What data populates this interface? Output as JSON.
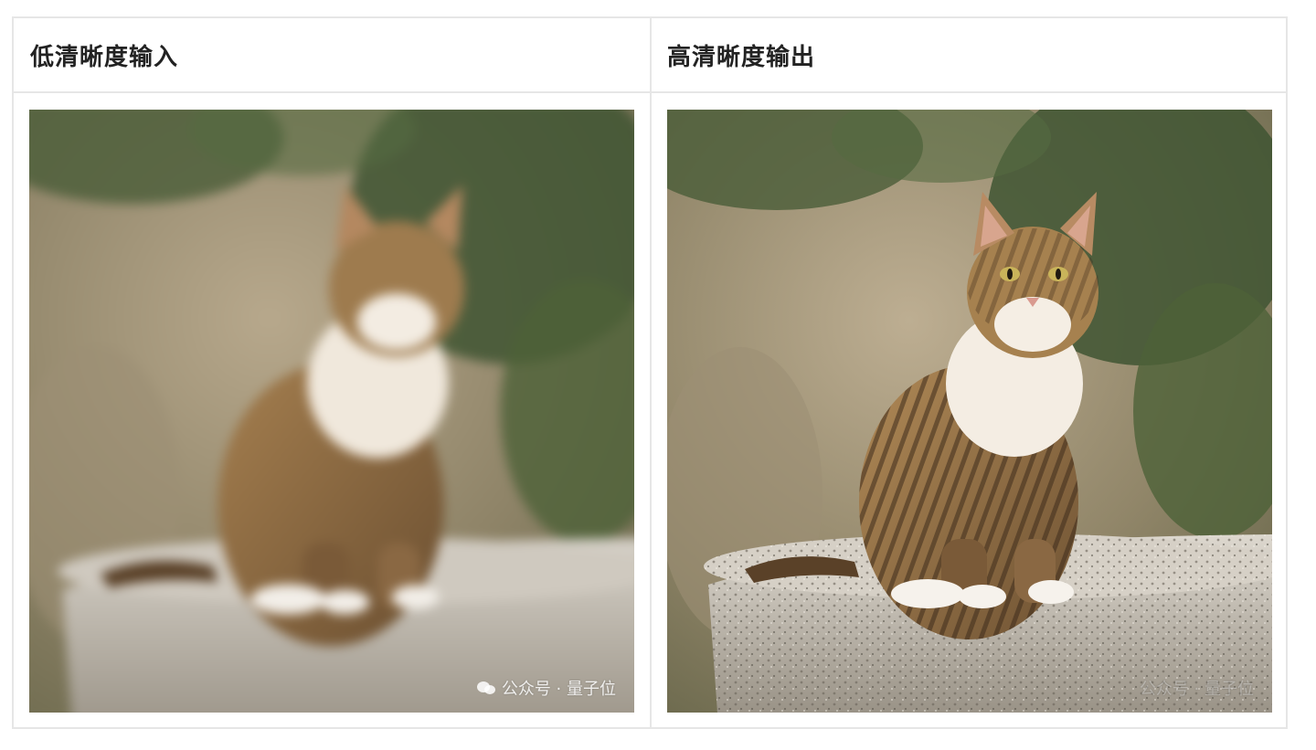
{
  "table": {
    "headers": [
      "低清晰度输入",
      "高清晰度输出"
    ]
  },
  "images": {
    "left_description_icon": "cat-photo-blurred",
    "right_description_icon": "cat-photo-sharp"
  },
  "watermark": {
    "text": "公众号 · 量子位",
    "icon": "wechat-icon"
  },
  "colors": {
    "border": "#e6e6e6",
    "header_text": "#222222"
  }
}
